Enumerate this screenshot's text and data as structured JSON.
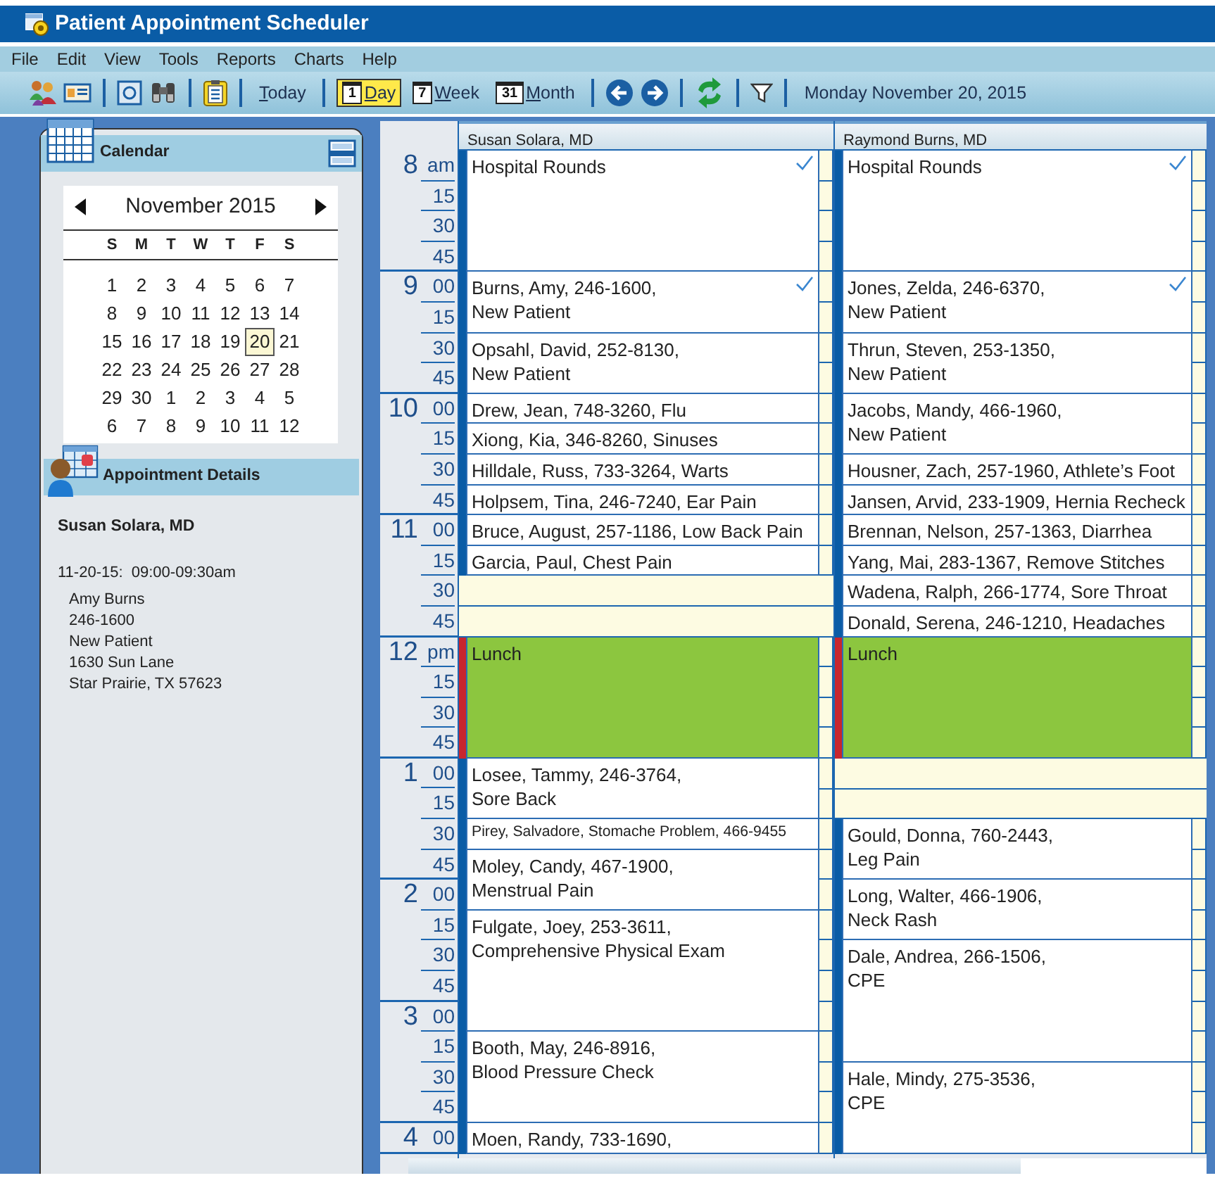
{
  "window": {
    "title": "Patient Appointment Scheduler"
  },
  "menu": [
    "File",
    "Edit",
    "View",
    "Tools",
    "Reports",
    "Charts",
    "Help"
  ],
  "toolbar": {
    "today": "Today",
    "views": [
      {
        "badge": "1",
        "label": "Day",
        "selected": true
      },
      {
        "badge": "7",
        "label": "Week",
        "selected": false
      },
      {
        "badge": "31",
        "label": "Month",
        "selected": false
      }
    ],
    "date": "Monday November 20, 2015"
  },
  "calendar_panel": {
    "title": "Calendar",
    "month": "November 2015",
    "weekdays": [
      "S",
      "M",
      "T",
      "W",
      "T",
      "F",
      "S"
    ],
    "weeks": [
      [
        {
          "label": "1",
          "selected": false
        },
        {
          "label": "2",
          "selected": false
        },
        {
          "label": "3",
          "selected": false
        },
        {
          "label": "4",
          "selected": false
        },
        {
          "label": "5",
          "selected": false
        },
        {
          "label": "6",
          "selected": false
        },
        {
          "label": "7",
          "selected": false
        }
      ],
      [
        {
          "label": "8",
          "selected": false
        },
        {
          "label": "9",
          "selected": false
        },
        {
          "label": "10",
          "selected": false
        },
        {
          "label": "11",
          "selected": false
        },
        {
          "label": "12",
          "selected": false
        },
        {
          "label": "13",
          "selected": false
        },
        {
          "label": "14",
          "selected": false
        }
      ],
      [
        {
          "label": "15",
          "selected": false
        },
        {
          "label": "16",
          "selected": false
        },
        {
          "label": "17",
          "selected": false
        },
        {
          "label": "18",
          "selected": false
        },
        {
          "label": "19",
          "selected": false
        },
        {
          "label": "20",
          "selected": true
        },
        {
          "label": "21",
          "selected": false
        }
      ],
      [
        {
          "label": "22",
          "selected": false
        },
        {
          "label": "23",
          "selected": false
        },
        {
          "label": "24",
          "selected": false
        },
        {
          "label": "25",
          "selected": false
        },
        {
          "label": "26",
          "selected": false
        },
        {
          "label": "27",
          "selected": false
        },
        {
          "label": "28",
          "selected": false
        }
      ],
      [
        {
          "label": "29",
          "selected": false
        },
        {
          "label": "30",
          "selected": false
        },
        {
          "label": "1",
          "selected": false
        },
        {
          "label": "2",
          "selected": false
        },
        {
          "label": "3",
          "selected": false
        },
        {
          "label": "4",
          "selected": false
        },
        {
          "label": "5",
          "selected": false
        }
      ],
      [
        {
          "label": "6",
          "selected": false
        },
        {
          "label": "7",
          "selected": false
        },
        {
          "label": "8",
          "selected": false
        },
        {
          "label": "9",
          "selected": false
        },
        {
          "label": "10",
          "selected": false
        },
        {
          "label": "11",
          "selected": false
        },
        {
          "label": "12",
          "selected": false
        }
      ]
    ]
  },
  "details_panel": {
    "title": "Appointment Details",
    "doctor": "Susan Solara, MD",
    "when": "11-20-15:  09:00-09:30am",
    "lines": [
      "Amy Burns",
      "246-1600",
      "New Patient",
      "1630 Sun Lane",
      "Star Prairie, TX 57623"
    ]
  },
  "time_axis": [
    {
      "hour": "8",
      "labels": [
        "am",
        "15",
        "30",
        "45"
      ]
    },
    {
      "hour": "9",
      "labels": [
        "00",
        "15",
        "30",
        "45"
      ]
    },
    {
      "hour": "10",
      "labels": [
        "00",
        "15",
        "30",
        "45"
      ]
    },
    {
      "hour": "11",
      "labels": [
        "00",
        "15",
        "30",
        "45"
      ]
    },
    {
      "hour": "12",
      "labels": [
        "pm",
        "15",
        "30",
        "45"
      ]
    },
    {
      "hour": "1",
      "labels": [
        "00",
        "15",
        "30",
        "45"
      ]
    },
    {
      "hour": "2",
      "labels": [
        "00",
        "15",
        "30",
        "45"
      ]
    },
    {
      "hour": "3",
      "labels": [
        "00",
        "15",
        "30",
        "45"
      ]
    },
    {
      "hour": "4",
      "labels": [
        "00"
      ]
    }
  ],
  "columns": [
    {
      "doctor": "Susan Solara, MD",
      "slots": [
        {
          "kind": "appointment",
          "lines": [
            "Hospital Rounds"
          ],
          "checked": true
        },
        {
          "kind": "continued"
        },
        {
          "kind": "continued"
        },
        {
          "kind": "continued"
        },
        {
          "kind": "appointment",
          "lines": [
            "Burns, Amy, 246-1600,",
            "New Patient"
          ],
          "checked": true
        },
        {
          "kind": "continued"
        },
        {
          "kind": "appointment",
          "lines": [
            "Opsahl, David, 252-8130,",
            "New Patient"
          ],
          "checked": false
        },
        {
          "kind": "continued"
        },
        {
          "kind": "appointment",
          "lines": [
            "Drew, Jean, 748-3260, Flu"
          ],
          "checked": false
        },
        {
          "kind": "appointment",
          "lines": [
            "Xiong, Kia, 346-8260, Sinuses"
          ],
          "checked": false
        },
        {
          "kind": "appointment",
          "lines": [
            "Hilldale, Russ, 733-3264, Warts"
          ],
          "checked": false
        },
        {
          "kind": "appointment",
          "lines": [
            "Holpsem, Tina, 246-7240, Ear Pain"
          ],
          "checked": false
        },
        {
          "kind": "appointment",
          "lines": [
            "Bruce, August, 257-1186, Low Back Pain"
          ],
          "checked": false
        },
        {
          "kind": "appointment",
          "lines": [
            "Garcia, Paul, Chest Pain"
          ],
          "checked": false
        },
        {
          "kind": "free"
        },
        {
          "kind": "free"
        },
        {
          "kind": "lunch",
          "lines": [
            "Lunch"
          ],
          "checked": false
        },
        {
          "kind": "continued"
        },
        {
          "kind": "continued"
        },
        {
          "kind": "continued"
        },
        {
          "kind": "appointment",
          "lines": [
            "Losee, Tammy, 246-3764,",
            "Sore Back"
          ],
          "checked": false
        },
        {
          "kind": "continued"
        },
        {
          "kind": "compact",
          "lines": [
            "Pirey, Salvadore, Stomache Problem, 466-9455"
          ],
          "checked": false
        },
        {
          "kind": "appointment",
          "lines": [
            "Moley, Candy, 467-1900,",
            "Menstrual Pain"
          ],
          "checked": false
        },
        {
          "kind": "continued"
        },
        {
          "kind": "appointment",
          "lines": [
            "Fulgate, Joey, 253-3611,",
            "Comprehensive Physical Exam"
          ],
          "checked": false
        },
        {
          "kind": "continued"
        },
        {
          "kind": "continued"
        },
        {
          "kind": "continued"
        },
        {
          "kind": "appointment",
          "lines": [
            "Booth, May, 246-8916,",
            "Blood Pressure Check"
          ],
          "checked": false
        },
        {
          "kind": "continued"
        },
        {
          "kind": "continued"
        },
        {
          "kind": "appointment",
          "lines": [
            "Moen, Randy, 733-1690,"
          ],
          "checked": false
        }
      ]
    },
    {
      "doctor": "Raymond Burns, MD",
      "slots": [
        {
          "kind": "appointment",
          "lines": [
            "Hospital Rounds"
          ],
          "checked": true
        },
        {
          "kind": "continued"
        },
        {
          "kind": "continued"
        },
        {
          "kind": "continued"
        },
        {
          "kind": "appointment",
          "lines": [
            "Jones, Zelda, 246-6370,",
            "New Patient"
          ],
          "checked": true
        },
        {
          "kind": "continued"
        },
        {
          "kind": "appointment",
          "lines": [
            "Thrun, Steven, 253-1350,",
            "New Patient"
          ],
          "checked": false
        },
        {
          "kind": "continued"
        },
        {
          "kind": "appointment",
          "lines": [
            "Jacobs, Mandy, 466-1960,",
            "New Patient"
          ],
          "checked": false
        },
        {
          "kind": "continued"
        },
        {
          "kind": "appointment",
          "lines": [
            "Housner, Zach, 257-1960, Athlete’s Foot"
          ],
          "checked": false
        },
        {
          "kind": "appointment",
          "lines": [
            "Jansen, Arvid, 233-1909, Hernia Recheck"
          ],
          "checked": false
        },
        {
          "kind": "appointment",
          "lines": [
            "Brennan, Nelson, 257-1363, Diarrhea"
          ],
          "checked": false
        },
        {
          "kind": "appointment",
          "lines": [
            "Yang, Mai, 283-1367, Remove Stitches"
          ],
          "checked": false
        },
        {
          "kind": "appointment",
          "lines": [
            "Wadena, Ralph, 266-1774, Sore Throat"
          ],
          "checked": false
        },
        {
          "kind": "appointment",
          "lines": [
            "Donald, Serena, 246-1210, Headaches"
          ],
          "checked": false
        },
        {
          "kind": "lunch",
          "lines": [
            "Lunch"
          ],
          "checked": false
        },
        {
          "kind": "continued"
        },
        {
          "kind": "continued"
        },
        {
          "kind": "continued"
        },
        {
          "kind": "free"
        },
        {
          "kind": "free"
        },
        {
          "kind": "appointment",
          "lines": [
            "Gould, Donna, 760-2443,",
            "Leg Pain"
          ],
          "checked": false
        },
        {
          "kind": "continued"
        },
        {
          "kind": "appointment",
          "lines": [
            "Long, Walter, 466-1906,",
            "Neck Rash"
          ],
          "checked": false
        },
        {
          "kind": "continued"
        },
        {
          "kind": "appointment",
          "lines": [
            "Dale, Andrea, 266-1506,",
            "CPE"
          ],
          "checked": false
        },
        {
          "kind": "continued"
        },
        {
          "kind": "continued"
        },
        {
          "kind": "continued"
        },
        {
          "kind": "appointment",
          "lines": [
            "Hale, Mindy, 275-3536,",
            "CPE"
          ],
          "checked": false
        },
        {
          "kind": "continued"
        },
        {
          "kind": "continued"
        }
      ]
    }
  ]
}
